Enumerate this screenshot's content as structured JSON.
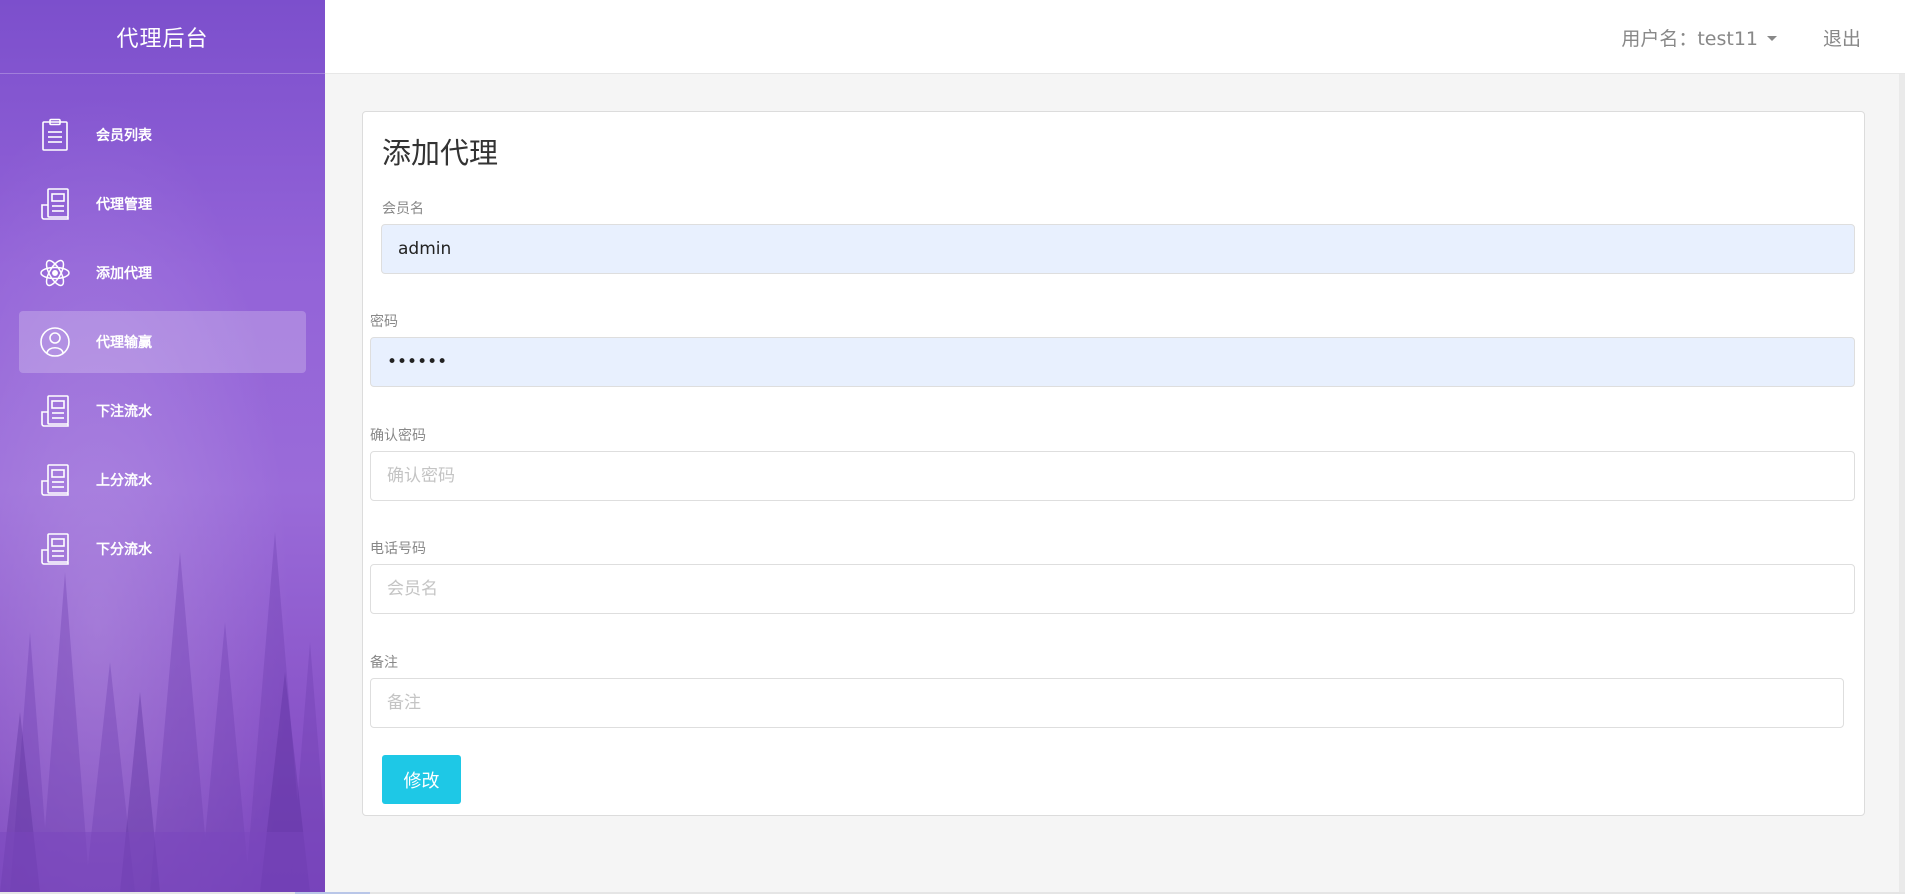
{
  "sidebar": {
    "brand": "代理后台",
    "items": [
      {
        "label": "会员列表",
        "icon": "clipboard-icon"
      },
      {
        "label": "代理管理",
        "icon": "document-icon"
      },
      {
        "label": "添加代理",
        "icon": "atom-icon"
      },
      {
        "label": "代理输赢",
        "icon": "user-circle-icon",
        "active": true
      },
      {
        "label": "下注流水",
        "icon": "document-icon"
      },
      {
        "label": "上分流水",
        "icon": "document-icon"
      },
      {
        "label": "下分流水",
        "icon": "document-icon"
      }
    ]
  },
  "header": {
    "user_label": "用户名：test11",
    "logout_label": "退出"
  },
  "form": {
    "title": "添加代理",
    "username": {
      "label": "会员名",
      "value": "admin",
      "placeholder": ""
    },
    "password": {
      "label": "密码",
      "value": "••••••",
      "placeholder": ""
    },
    "confirm_password": {
      "label": "确认密码",
      "value": "",
      "placeholder": "确认密码"
    },
    "phone": {
      "label": "电话号码",
      "value": "",
      "placeholder": "会员名"
    },
    "remark": {
      "label": "备注",
      "value": "",
      "placeholder": "备注"
    },
    "submit_label": "修改"
  },
  "colors": {
    "sidebar": "#9363d8",
    "button": "#1ec8e6",
    "autofill": "#e8f0fe"
  }
}
